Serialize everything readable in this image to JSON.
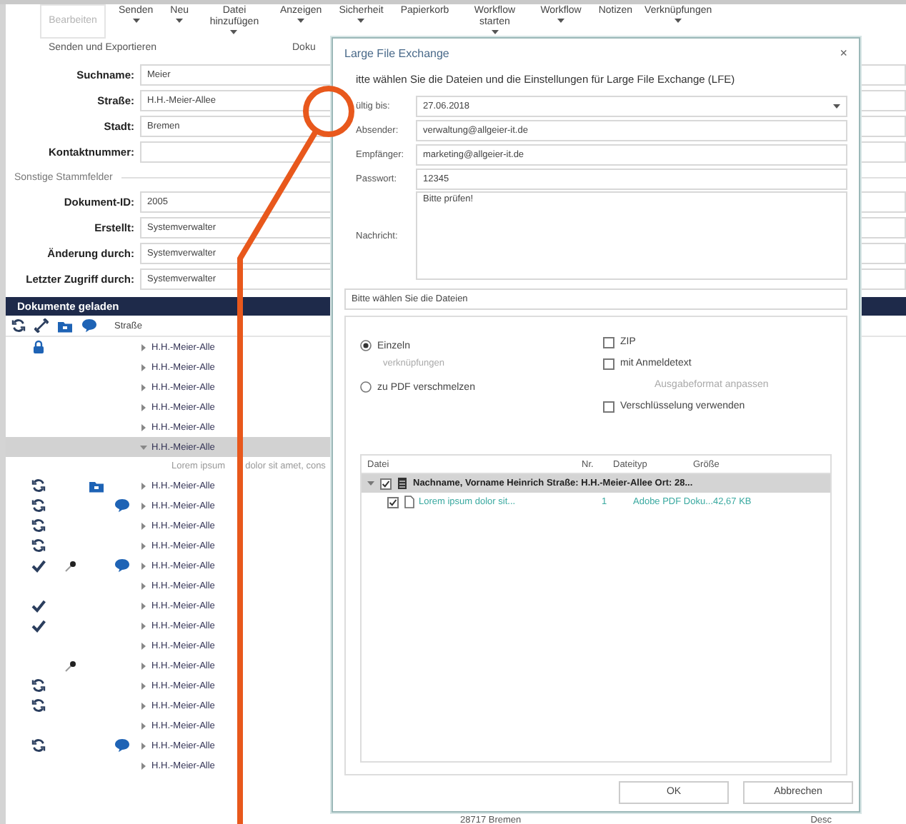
{
  "ribbon": {
    "buttons": [
      {
        "label": "Bearbeiten",
        "dropdown": false,
        "disabled": true
      },
      {
        "label": "Senden",
        "dropdown": true,
        "disabled": false
      },
      {
        "label": "Neu",
        "dropdown": true,
        "disabled": false
      },
      {
        "label": "Datei hinzufügen",
        "dropdown": true,
        "disabled": false
      },
      {
        "label": "Anzeigen",
        "dropdown": true,
        "disabled": false
      },
      {
        "label": "Sicherheit",
        "dropdown": true,
        "disabled": false
      },
      {
        "label": "Papierkorb",
        "dropdown": false,
        "disabled": false
      },
      {
        "label": "Workflow starten",
        "dropdown": true,
        "disabled": false
      },
      {
        "label": "Workflow",
        "dropdown": true,
        "disabled": false
      },
      {
        "label": "Notizen",
        "dropdown": false,
        "disabled": false
      },
      {
        "label": "Verknüpfungen",
        "dropdown": true,
        "disabled": false
      }
    ],
    "groups": [
      "Senden und Exportieren",
      "Doku"
    ]
  },
  "form": {
    "fields": [
      {
        "label": "Suchname:",
        "value": "Meier"
      },
      {
        "label": "Straße:",
        "value": "H.H.-Meier-Allee"
      },
      {
        "label": "Stadt:",
        "value": "Bremen"
      },
      {
        "label": "Kontaktnummer:"
      }
    ],
    "section": "Sonstige Stammfelder",
    "system_fields": [
      {
        "label": "Dokument-ID:",
        "value": "2005"
      },
      {
        "label": "Erstellt:",
        "value": "Systemverwalter"
      },
      {
        "label": "Änderung durch:",
        "value": "Systemverwalter"
      },
      {
        "label": "Letzter Zugriff durch:",
        "value": "Systemverwalter"
      }
    ]
  },
  "documents": {
    "header": "Dokumente geladen",
    "column": "Straße",
    "rows": [
      {
        "street": "H.H.-Meier-Alle",
        "selected": false,
        "expanded": false,
        "kind": "lock",
        "badges": []
      },
      {
        "street": "H.H.-Meier-Alle",
        "selected": false,
        "expanded": false,
        "kind": "plain",
        "badges": []
      },
      {
        "street": "H.H.-Meier-Alle",
        "selected": false,
        "expanded": false,
        "kind": "plain",
        "badges": []
      },
      {
        "street": "H.H.-Meier-Alle",
        "selected": false,
        "expanded": false,
        "kind": "plain",
        "badges": []
      },
      {
        "street": "H.H.-Meier-Alle",
        "selected": false,
        "expanded": false,
        "kind": "plain",
        "badges": []
      },
      {
        "street": "H.H.-Meier-Alle",
        "selected": true,
        "expanded": true,
        "kind": "plain",
        "badges": [],
        "note": [
          "Lorem ipsum",
          "dolor sit amet, cons"
        ]
      },
      {
        "street": "H.H.-Meier-Alle",
        "selected": false,
        "expanded": false,
        "kind": "sync",
        "badges": [
          {
            "kind": "folder"
          }
        ]
      },
      {
        "street": "H.H.-Meier-Alle",
        "selected": false,
        "expanded": false,
        "kind": "sync",
        "badges": [
          {
            "kind": "comment"
          }
        ]
      },
      {
        "street": "H.H.-Meier-Alle",
        "selected": false,
        "expanded": false,
        "kind": "sync",
        "badges": []
      },
      {
        "street": "H.H.-Meier-Alle",
        "selected": false,
        "expanded": false,
        "kind": "sync",
        "badges": []
      },
      {
        "street": "H.H.-Meier-Alle",
        "selected": false,
        "expanded": false,
        "kind": "check",
        "badges": [
          {
            "kind": "pin"
          },
          {
            "kind": "comment"
          }
        ]
      },
      {
        "street": "H.H.-Meier-Alle",
        "selected": false,
        "expanded": false,
        "kind": "plain",
        "badges": []
      },
      {
        "street": "H.H.-Meier-Alle",
        "selected": false,
        "expanded": false,
        "kind": "check",
        "badges": []
      },
      {
        "street": "H.H.-Meier-Alle",
        "selected": false,
        "expanded": false,
        "kind": "check",
        "badges": []
      },
      {
        "street": "H.H.-Meier-Alle",
        "selected": false,
        "expanded": false,
        "kind": "plain",
        "badges": []
      },
      {
        "street": "H.H.-Meier-Alle",
        "selected": false,
        "expanded": false,
        "kind": "plain",
        "badges": [
          {
            "kind": "pin"
          }
        ]
      },
      {
        "street": "H.H.-Meier-Alle",
        "selected": false,
        "expanded": false,
        "kind": "sync",
        "badges": []
      },
      {
        "street": "H.H.-Meier-Alle",
        "selected": false,
        "expanded": false,
        "kind": "sync",
        "badges": []
      },
      {
        "street": "H.H.-Meier-Alle",
        "selected": false,
        "expanded": false,
        "kind": "plain",
        "badges": []
      },
      {
        "street": "H.H.-Meier-Alle",
        "selected": false,
        "expanded": false,
        "kind": "sync",
        "badges": [
          {
            "kind": "comment"
          }
        ]
      },
      {
        "street": "H.H.-Meier-Alle",
        "selected": false,
        "expanded": false,
        "kind": "plain",
        "badges": []
      }
    ]
  },
  "dialog": {
    "title": "Large File Exchange",
    "close": "×",
    "instruction": "itte wählen Sie die Dateien und die Einstellungen für Large File Exchange (LFE)",
    "fields": [
      {
        "kind": "date",
        "label": "ültig bis:",
        "value": "27.06.2018"
      },
      {
        "kind": "text",
        "label": "Absender:",
        "value": "verwaltung@allgeier-it.de"
      },
      {
        "kind": "text",
        "label": "Empfänger:",
        "value": "marketing@allgeier-it.de"
      },
      {
        "kind": "text",
        "label": "Passwort:",
        "value": "12345"
      },
      {
        "kind": "textarea",
        "label": "Nachricht:",
        "value": "Bitte prüfen!"
      }
    ],
    "files_hint": "Bitte wählen Sie die Dateien",
    "radios": [
      {
        "label": "Einzeln",
        "selected": true,
        "sub": "verknüpfungen"
      },
      {
        "label": "zu PDF verschmelzen",
        "selected": false
      }
    ],
    "checkboxes": [
      {
        "label": "ZIP",
        "checked": false,
        "disabled": false
      },
      {
        "label": "mit Anmeldetext",
        "checked": false,
        "disabled": false
      },
      {
        "label": "Ausgabeformat anpassen",
        "disabled": true
      },
      {
        "label": "Verschlüsselung verwenden",
        "checked": false,
        "disabled": false
      }
    ],
    "table": {
      "columns": [
        "Datei",
        "Nr.",
        "Dateityp",
        "Größe"
      ],
      "group": {
        "label": "Nachname, Vorname Heinrich Straße: H.H.-Meier-Allee Ort: 28...",
        "checked": true,
        "expanded": true
      },
      "rows": [
        {
          "checked": true,
          "cells": [
            "Lorem ipsum dolor sit...",
            "1",
            "Adobe PDF Doku...",
            "42,67 KB"
          ]
        }
      ]
    },
    "buttons": [
      "OK",
      "Abbrechen"
    ]
  },
  "status_bar": [
    "28717 Bremen",
    "Desc"
  ]
}
